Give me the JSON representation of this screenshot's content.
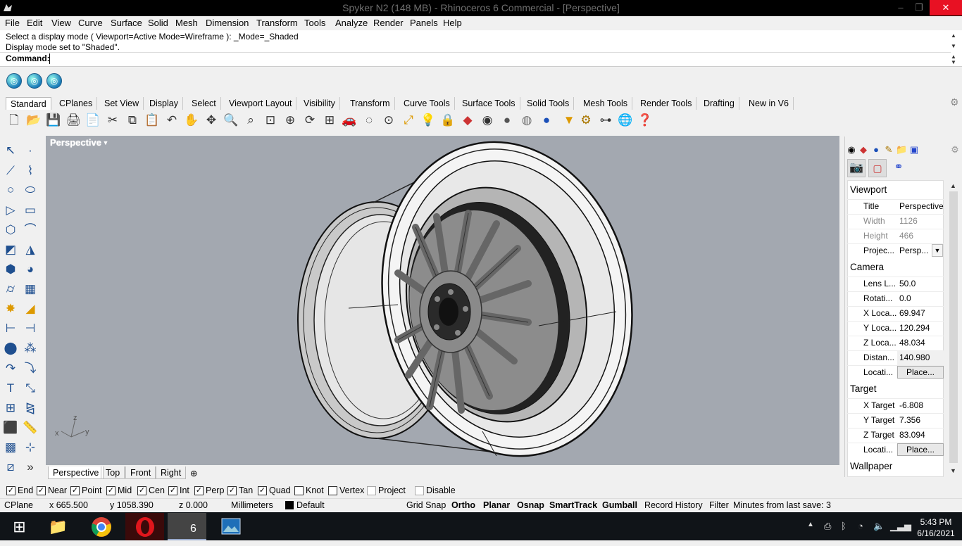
{
  "window": {
    "title": "Spyker N2 (148 MB) - Rhinoceros 6 Commercial - [Perspective]",
    "minimize": "–",
    "maximize": "❐",
    "close": "✕"
  },
  "menu": [
    "File",
    "Edit",
    "View",
    "Curve",
    "Surface",
    "Solid",
    "Mesh",
    "Dimension",
    "Transform",
    "Tools",
    "Analyze",
    "Render",
    "Panels",
    "Help"
  ],
  "command": {
    "line1": "Select a display mode ( Viewport=Active  Mode=Wireframe ): _Mode=_Shaded",
    "line2": "Display mode set to \"Shaded\".",
    "prompt": "Command:"
  },
  "toolbar_tabs": [
    "Standard",
    "CPlanes",
    "Set View",
    "Display",
    "Select",
    "Viewport Layout",
    "Visibility",
    "Transform",
    "Curve Tools",
    "Surface Tools",
    "Solid Tools",
    "Mesh Tools",
    "Render Tools",
    "Drafting",
    "New in V6"
  ],
  "standard_icons": [
    "new-icon",
    "open-icon",
    "save-icon",
    "print-icon",
    "import-icon",
    "cut-icon",
    "copy-icon",
    "paste-icon",
    "undo-icon",
    "pan-icon",
    "rotate-icon",
    "zoom-icon",
    "zoom-window-icon",
    "zoom-extents-icon",
    "zoom-selected-icon",
    "rotate-view-icon",
    "four-view-icon",
    "car-icon",
    "hide-icon",
    "show-icon",
    "transform-icon",
    "light-icon",
    "lock-icon",
    "layer-icon",
    "color-wheel-icon",
    "wireframe-ball-icon",
    "shaded-ball-icon",
    "rendered-ball-icon",
    "render-ball-icon",
    "highlight-icon",
    "options-icon",
    "snap-icon",
    "render-globe-icon",
    "help-icon"
  ],
  "viewport": {
    "label": "Perspective",
    "axes": {
      "z": "z",
      "x": "x",
      "y": "y"
    },
    "bg": "#a3a8b0"
  },
  "viewport_tabs": [
    "Perspective",
    "Top",
    "Front",
    "Right"
  ],
  "properties": {
    "sections": {
      "viewport": "Viewport",
      "camera": "Camera",
      "target": "Target",
      "wallpaper": "Wallpaper"
    },
    "viewport_rows": [
      {
        "label": "Title",
        "value": "Perspective"
      },
      {
        "label": "Width",
        "value": "1126"
      },
      {
        "label": "Height",
        "value": "466"
      },
      {
        "label": "Projec...",
        "value": "Persp..."
      }
    ],
    "camera_rows": [
      {
        "label": "Lens L...",
        "value": "50.0"
      },
      {
        "label": "Rotati...",
        "value": "0.0"
      },
      {
        "label": "X Loca...",
        "value": "69.947"
      },
      {
        "label": "Y Loca...",
        "value": "120.294"
      },
      {
        "label": "Z Loca...",
        "value": "48.034"
      },
      {
        "label": "Distan...",
        "value": "140.980"
      },
      {
        "label": "Locati...",
        "value": "Place..."
      }
    ],
    "target_rows": [
      {
        "label": "X Target",
        "value": "-6.808"
      },
      {
        "label": "Y Target",
        "value": "7.356"
      },
      {
        "label": "Z Target",
        "value": "83.094"
      },
      {
        "label": "Locati...",
        "value": "Place..."
      }
    ]
  },
  "osnaps": [
    {
      "label": "End",
      "checked": true
    },
    {
      "label": "Near",
      "checked": true
    },
    {
      "label": "Point",
      "checked": true
    },
    {
      "label": "Mid",
      "checked": true
    },
    {
      "label": "Cen",
      "checked": true
    },
    {
      "label": "Int",
      "checked": true
    },
    {
      "label": "Perp",
      "checked": true
    },
    {
      "label": "Tan",
      "checked": true
    },
    {
      "label": "Quad",
      "checked": true
    },
    {
      "label": "Knot",
      "checked": false
    },
    {
      "label": "Vertex",
      "checked": false
    },
    {
      "label": "Project",
      "checked": false
    },
    {
      "label": "Disable",
      "checked": false
    }
  ],
  "status": {
    "cplane": "CPlane",
    "x": "x 665.500",
    "y": "y 1058.390",
    "z": "z 0.000",
    "units": "Millimeters",
    "layer": "Default",
    "grid_snap": "Grid Snap",
    "ortho": "Ortho",
    "planar": "Planar",
    "osnap": "Osnap",
    "smarttrack": "SmartTrack",
    "gumball": "Gumball",
    "record_history": "Record History",
    "filter": "Filter",
    "save_msg": "Minutes from last save: 3"
  },
  "taskbar": {
    "rhino_label": "6",
    "time": "5:43 PM",
    "date": "6/16/2021"
  }
}
